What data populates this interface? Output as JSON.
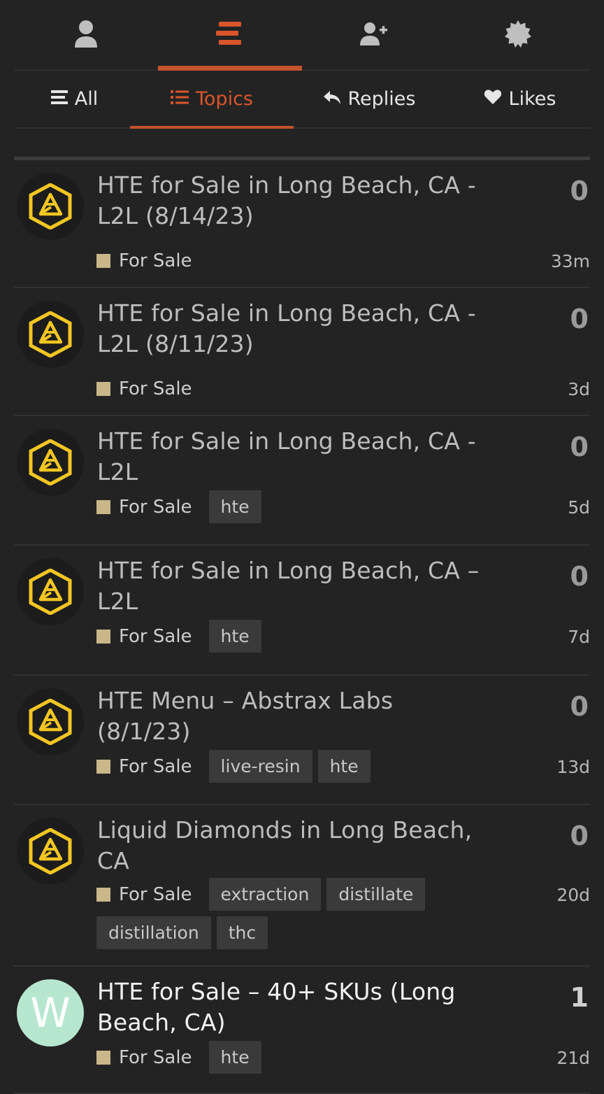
{
  "top_nav": [
    {
      "icon": "user-icon",
      "active": false
    },
    {
      "icon": "stream-icon",
      "active": true
    },
    {
      "icon": "user-plus-icon",
      "active": false
    },
    {
      "icon": "badge-icon",
      "active": false
    }
  ],
  "sub_nav": [
    {
      "label": "All",
      "icon": "list-icon"
    },
    {
      "label": "Topics",
      "icon": "list-ul-icon"
    },
    {
      "label": "Replies",
      "icon": "reply-icon"
    },
    {
      "label": "Likes",
      "icon": "heart-icon"
    }
  ],
  "colors": {
    "accent": "#c4522d",
    "category": "#c9b78a"
  },
  "topics": [
    {
      "title": "HTE for Sale in Long Beach, CA - L2L (8/14/23)",
      "count": "0",
      "category": "For Sale",
      "tags": [],
      "age": "33m",
      "avatar": "logo"
    },
    {
      "title": "HTE for Sale in Long Beach, CA - L2L (8/11/23)",
      "count": "0",
      "category": "For Sale",
      "tags": [],
      "age": "3d",
      "avatar": "logo"
    },
    {
      "title": "HTE for Sale in Long Beach, CA - L2L",
      "count": "0",
      "category": "For Sale",
      "tags": [
        "hte"
      ],
      "age": "5d",
      "avatar": "logo"
    },
    {
      "title": "HTE for Sale in Long Beach, CA – L2L",
      "count": "0",
      "category": "For Sale",
      "tags": [
        "hte"
      ],
      "age": "7d",
      "avatar": "logo"
    },
    {
      "title": "HTE Menu – Abstrax Labs (8/1/23)",
      "count": "0",
      "category": "For Sale",
      "tags": [
        "live-resin",
        "hte"
      ],
      "age": "13d",
      "avatar": "logo"
    },
    {
      "title": "Liquid Diamonds in Long Beach, CA",
      "count": "0",
      "category": "For Sale",
      "tags": [
        "extraction",
        "distillate",
        "distillation",
        "thc"
      ],
      "age": "20d",
      "avatar": "logo"
    },
    {
      "title": "HTE for Sale – 40+ SKUs (Long Beach, CA)",
      "count": "1",
      "category": "For Sale",
      "tags": [
        "hte"
      ],
      "age": "21d",
      "avatar": "W"
    }
  ]
}
